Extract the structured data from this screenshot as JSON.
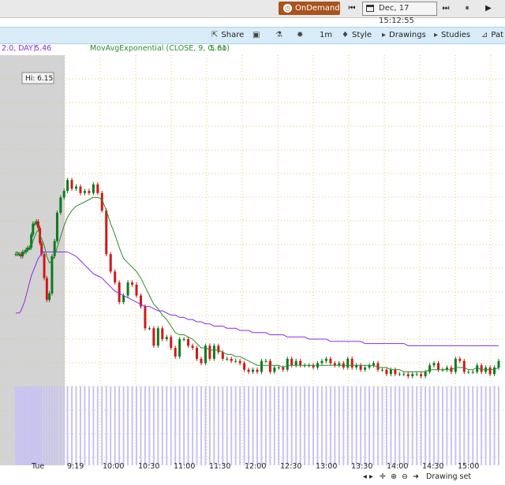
{
  "topbar": {
    "ondemand_label": "OnDemand",
    "ondemand_icon": "clock-icon",
    "date_time": "Dec, 17 15:12:55",
    "skip_back_icon": "skip-back-icon",
    "skip_forward_icon": "skip-forward-icon",
    "pause_icon": "pause-icon",
    "play_icon": "play-icon"
  },
  "toolbar": {
    "share": "Share",
    "timeframe": "1m",
    "style": "Style",
    "drawings": "Drawings",
    "studies": "Studies",
    "patterns": "Pat"
  },
  "legend": {
    "study1": "2.0, DAY)",
    "study1_value": "5.46",
    "study2": "MovAvgExponential (CLOSE, 9, 0, no)",
    "study2_value": "5.61"
  },
  "colors": {
    "up_bar": "#0d7a1e",
    "down_bar": "#d01818",
    "ema_line": "#2e8b2e",
    "vwap_line": "#8a2be2",
    "volume": "#c8c3f2",
    "premarket_shade": "#d3d3d3",
    "grid": "#e0b84a",
    "ondemand_bg": "#a8541e",
    "toolbar_bg": "#d8ecf7"
  },
  "chart_data": {
    "type": "candlestick",
    "high_label": "Hi: 6.15",
    "x": [
      "Tue",
      "9:19",
      "10:00",
      "10:30",
      "11:00",
      "11:30",
      "12:00",
      "12:30",
      "13:00",
      "13:30",
      "14:00",
      "14:30",
      "15:00"
    ],
    "price_series": {
      "t": [
        0,
        2,
        4,
        6,
        8,
        10,
        12,
        14,
        16,
        18,
        20,
        22,
        24,
        26,
        28,
        30,
        33,
        36,
        39,
        42,
        45,
        48,
        52,
        56,
        60,
        65,
        70,
        75,
        80,
        85,
        90,
        95,
        100,
        105,
        110,
        115,
        120,
        125,
        130,
        135,
        140,
        145,
        150,
        155,
        160,
        165,
        170,
        175,
        180,
        185,
        190,
        195,
        200,
        205,
        210,
        215,
        220,
        225,
        230,
        235,
        240,
        245,
        250,
        255,
        260,
        265,
        270,
        275,
        280,
        285,
        290,
        295,
        300,
        305,
        310,
        315,
        320,
        325,
        330,
        335,
        340,
        345,
        350,
        355,
        360,
        365,
        370,
        375,
        380,
        385,
        390,
        395,
        400,
        405,
        410,
        415,
        420,
        425,
        430,
        435,
        440,
        445,
        450,
        455,
        460,
        465,
        470,
        475,
        480,
        485,
        490,
        495,
        500,
        505,
        510,
        515,
        520,
        525,
        530,
        535,
        540,
        545,
        550,
        555,
        560
      ],
      "close": [
        5.46,
        5.46,
        5.46,
        5.45,
        5.47,
        5.47,
        5.48,
        5.49,
        5.49,
        5.55,
        5.6,
        5.6,
        5.61,
        5.58,
        5.51,
        5.46,
        5.35,
        5.25,
        5.28,
        5.45,
        5.52,
        5.65,
        5.72,
        5.75,
        5.8,
        5.76,
        5.77,
        5.74,
        5.75,
        5.74,
        5.78,
        5.74,
        5.66,
        5.46,
        5.38,
        5.33,
        5.24,
        5.27,
        5.33,
        5.32,
        5.27,
        5.22,
        5.12,
        5.12,
        5.04,
        5.12,
        5.07,
        5.08,
        5.03,
        4.99,
        5.07,
        5.07,
        5.04,
        5.03,
        4.98,
        4.96,
        5.04,
        4.98,
        5.04,
        5.01,
        4.98,
        4.98,
        4.97,
        4.97,
        4.96,
        4.93,
        4.92,
        4.93,
        4.92,
        4.97,
        4.97,
        4.92,
        4.94,
        4.94,
        4.93,
        4.98,
        4.95,
        4.97,
        4.95,
        4.95,
        4.95,
        4.94,
        4.96,
        4.97,
        4.98,
        4.96,
        4.95,
        4.96,
        4.94,
        4.98,
        4.94,
        4.95,
        4.93,
        4.94,
        4.95,
        4.96,
        4.93,
        4.93,
        4.91,
        4.93,
        4.91,
        4.91,
        4.91,
        4.9,
        4.91,
        4.91,
        4.9,
        4.92,
        4.95,
        4.96,
        4.93,
        4.93,
        4.94,
        4.92,
        4.98,
        4.97,
        4.92,
        4.92,
        4.92,
        4.95,
        4.92,
        4.94,
        4.91,
        4.94,
        4.97
      ]
    },
    "ema": [
      5.47,
      5.47,
      5.46,
      5.46,
      5.47,
      5.47,
      5.47,
      5.48,
      5.48,
      5.49,
      5.52,
      5.54,
      5.56,
      5.57,
      5.55,
      5.53,
      5.5,
      5.45,
      5.42,
      5.43,
      5.45,
      5.49,
      5.54,
      5.59,
      5.63,
      5.66,
      5.68,
      5.69,
      5.7,
      5.71,
      5.72,
      5.72,
      5.71,
      5.66,
      5.6,
      5.55,
      5.49,
      5.44,
      5.42,
      5.4,
      5.38,
      5.35,
      5.31,
      5.27,
      5.23,
      5.21,
      5.18,
      5.16,
      5.13,
      5.1,
      5.09,
      5.09,
      5.08,
      5.07,
      5.05,
      5.03,
      5.03,
      5.02,
      5.02,
      5.02,
      5.01,
      5.0,
      5.0,
      4.99,
      4.99,
      4.98,
      4.97,
      4.96,
      4.95,
      4.95,
      4.95,
      4.95,
      4.95,
      4.95,
      4.94,
      4.95,
      4.95,
      4.95,
      4.95,
      4.95,
      4.95,
      4.95,
      4.95,
      4.95,
      4.95,
      4.95,
      4.95,
      4.95,
      4.95,
      4.95,
      4.95,
      4.95,
      4.95,
      4.95,
      4.95,
      4.95,
      4.94,
      4.94,
      4.94,
      4.93,
      4.93,
      4.93,
      4.92,
      4.92,
      4.92,
      4.92,
      4.92,
      4.92,
      4.93,
      4.93,
      4.93,
      4.93,
      4.93,
      4.93,
      4.94,
      4.94,
      4.94,
      4.93,
      4.93,
      4.94,
      4.93,
      4.93,
      4.93,
      4.93,
      4.94
    ],
    "vwap": [
      5.19,
      5.19,
      5.19,
      5.2,
      5.22,
      5.24,
      5.27,
      5.3,
      5.33,
      5.36,
      5.38,
      5.4,
      5.42,
      5.44,
      5.45,
      5.47,
      5.47,
      5.47,
      5.47,
      5.47,
      5.47,
      5.47,
      5.47,
      5.47,
      5.47,
      5.46,
      5.45,
      5.43,
      5.41,
      5.39,
      5.37,
      5.36,
      5.35,
      5.33,
      5.31,
      5.29,
      5.28,
      5.27,
      5.26,
      5.25,
      5.24,
      5.23,
      5.22,
      5.22,
      5.21,
      5.2,
      5.2,
      5.19,
      5.18,
      5.18,
      5.17,
      5.17,
      5.16,
      5.16,
      5.15,
      5.15,
      5.14,
      5.14,
      5.13,
      5.13,
      5.13,
      5.12,
      5.12,
      5.12,
      5.11,
      5.11,
      5.11,
      5.1,
      5.1,
      5.1,
      5.1,
      5.09,
      5.09,
      5.09,
      5.09,
      5.08,
      5.08,
      5.08,
      5.08,
      5.08,
      5.07,
      5.07,
      5.07,
      5.07,
      5.07,
      5.06,
      5.06,
      5.06,
      5.06,
      5.06,
      5.06,
      5.06,
      5.06,
      5.05,
      5.05,
      5.05,
      5.05,
      5.05,
      5.05,
      5.05,
      5.05,
      5.05,
      5.05,
      5.04,
      5.04,
      5.04,
      5.04,
      5.04,
      5.04,
      5.04,
      5.04,
      5.04,
      5.04,
      5.04,
      5.04,
      5.04,
      5.04,
      5.04,
      5.04,
      5.04,
      5.04,
      5.04,
      5.04,
      5.04,
      5.04
    ],
    "volume": [
      5,
      5,
      5,
      5,
      5,
      5,
      5,
      5,
      5,
      5,
      5,
      5,
      5,
      5,
      5,
      5,
      5,
      5,
      5,
      5,
      5,
      5,
      5,
      5,
      5,
      5,
      5,
      5,
      5,
      5,
      5,
      5,
      5,
      5,
      5,
      5,
      5,
      5,
      5,
      5,
      5,
      5,
      5,
      5,
      5,
      5,
      5,
      5,
      5,
      5,
      5,
      5,
      5,
      5,
      5,
      5,
      5,
      5,
      5,
      5,
      5,
      5,
      5,
      5,
      5,
      5,
      5,
      5,
      5,
      5,
      5,
      5,
      5,
      5,
      5,
      5,
      5,
      5,
      5,
      5,
      5,
      5,
      5,
      5,
      5,
      5,
      5,
      5,
      5,
      5,
      5,
      5,
      5,
      5,
      5,
      5,
      5,
      5,
      5,
      5,
      5,
      5,
      5,
      5,
      5,
      5,
      5,
      5,
      5,
      5,
      5,
      5,
      5,
      5,
      5,
      5,
      5,
      5,
      5,
      5,
      5,
      5,
      5,
      5,
      5
    ],
    "grid": true
  },
  "status": {
    "drawing_label": "Drawing set"
  }
}
